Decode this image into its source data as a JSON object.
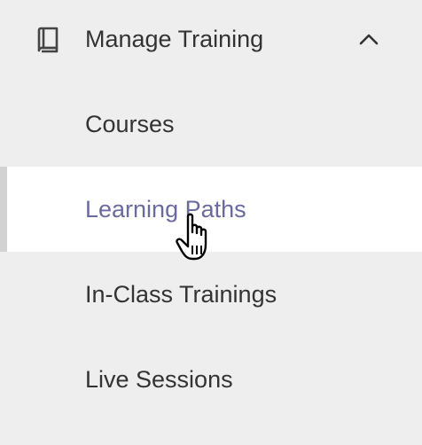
{
  "nav": {
    "section": {
      "title": "Manage Training",
      "icon": "book-icon",
      "expanded": true,
      "toggle_icon": "chevron-up-icon"
    },
    "items": [
      {
        "label": "Courses",
        "active": false
      },
      {
        "label": "Learning Paths",
        "active": true
      },
      {
        "label": "In-Class Trainings",
        "active": false
      },
      {
        "label": "Live Sessions",
        "active": false
      }
    ]
  },
  "colors": {
    "background": "#eeeeee",
    "active_background": "#ffffff",
    "active_text": "#6a6aa0",
    "text": "#333333",
    "active_indicator": "#d2d2d2"
  },
  "cursor": {
    "icon": "hand-pointer-icon"
  }
}
